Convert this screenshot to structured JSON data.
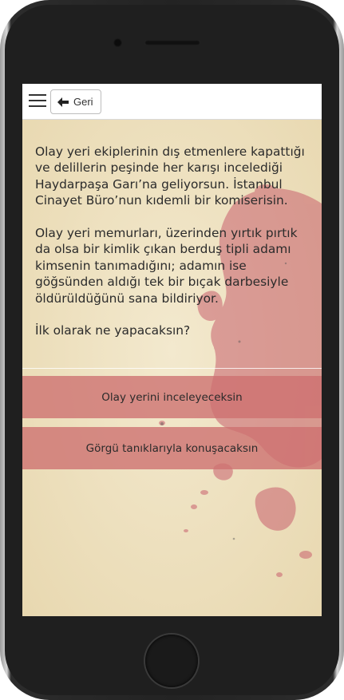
{
  "toolbar": {
    "back_label": "Geri"
  },
  "story": {
    "paragraphs": [
      "Olay yeri ekiplerinin dış etmenlere kapattığı ve delillerin peşinde her karışı incelediği Haydarpaşa Garı’na geliyorsun. İstanbul Cinayet Büro’nun kıdemli bir komiserisin.",
      "Olay yeri memurları, üzerinden yırtık pırtık da olsa bir kimlik çıkan berduş tipli adamı kimsenin tanımadığını; adamın ise göğsünden aldığı tek bir bıçak darbesiyle öldürüldüğünü sana bildiriyor."
    ],
    "question": "İlk olarak ne yapacaksın?"
  },
  "choices": [
    {
      "label": "Olay yerini inceleyeceksin"
    },
    {
      "label": "Görgü tanıklarıyla konuşacaksın"
    }
  ],
  "colors": {
    "background": "#efe3c3",
    "choice": "#cd7070",
    "stain": "#c8606e"
  },
  "icons": {
    "menu": "hamburger-menu-icon",
    "back": "arrow-left-icon"
  }
}
